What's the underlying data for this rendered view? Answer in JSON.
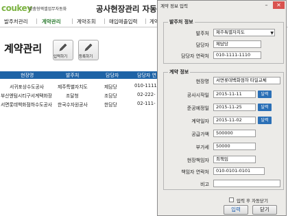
{
  "header": {
    "logo_main": "coukey",
    "logo_sub": "맞춤형액셀업무자동화",
    "title": "공사현장관리 자동화 프"
  },
  "nav_tabs": [
    "발주처관리",
    "계약관리",
    "계약조회",
    "매입매출입력",
    "계약관"
  ],
  "page": {
    "title": "계약관리",
    "btn_input": "입력하기",
    "btn_register": "등록하기"
  },
  "grid": {
    "headers": [
      "현장명",
      "발주처",
      "담당자",
      "담당자 연"
    ],
    "rows": [
      [
        "서귀포상수도공사",
        "제주특별자치도",
        "제담당",
        "010-1111-"
      ],
      [
        "부산엔텀시티구서계택화장",
        "조달청",
        "조담당",
        "02-222-"
      ],
      [
        "서면롯데백화점하수도공사",
        "한국수자원공사",
        "한담당",
        "02-111-"
      ]
    ]
  },
  "dialog": {
    "title": "계약 정보 입력",
    "client_section": "발주처 정보",
    "client_label": "발주처",
    "client_value": "제주특별자치도",
    "manager_label": "담당자",
    "manager_value": "제담당",
    "manager_phone_label": "담당자 연락처",
    "manager_phone_value": "010-1111-1110",
    "contract_section": "계약 정보",
    "site_label": "현장명",
    "site_value": "서면롯데백화점하 타일교체",
    "start_label": "공사시작일",
    "start_value": "2015-11-11",
    "completion_label": "준공예정일",
    "completion_value": "2015-11-25",
    "contract_date_label": "계약일자",
    "contract_date_value": "2015-11-02",
    "supply_label": "공급가액",
    "supply_value": "500000",
    "vat_label": "부가세",
    "vat_value": "50000",
    "site_manager_label": "현장책임자",
    "site_manager_value": "최책임",
    "resp_phone_label": "책임자 연락처",
    "resp_phone_value": "010-0101-0101",
    "remark_label": "비고",
    "remark_value": "",
    "calendar_btn": "달력",
    "autoclose_label": "입력 후 자동닫기",
    "submit_btn": "입력",
    "close_btn": "닫기"
  },
  "colors": {
    "grid_header": "#1e63a6",
    "active_tab": "#2e7d32",
    "calendar_button": "#2a6fb6"
  }
}
